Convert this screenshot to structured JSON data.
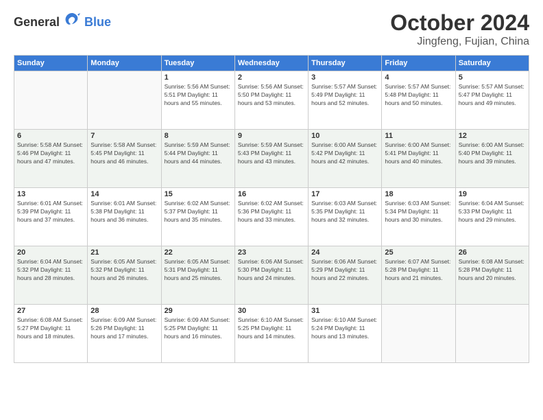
{
  "header": {
    "logo_general": "General",
    "logo_blue": "Blue",
    "month": "October 2024",
    "location": "Jingfeng, Fujian, China"
  },
  "weekdays": [
    "Sunday",
    "Monday",
    "Tuesday",
    "Wednesday",
    "Thursday",
    "Friday",
    "Saturday"
  ],
  "weeks": [
    [
      {
        "day": "",
        "info": ""
      },
      {
        "day": "",
        "info": ""
      },
      {
        "day": "1",
        "info": "Sunrise: 5:56 AM\nSunset: 5:51 PM\nDaylight: 11 hours and 55 minutes."
      },
      {
        "day": "2",
        "info": "Sunrise: 5:56 AM\nSunset: 5:50 PM\nDaylight: 11 hours and 53 minutes."
      },
      {
        "day": "3",
        "info": "Sunrise: 5:57 AM\nSunset: 5:49 PM\nDaylight: 11 hours and 52 minutes."
      },
      {
        "day": "4",
        "info": "Sunrise: 5:57 AM\nSunset: 5:48 PM\nDaylight: 11 hours and 50 minutes."
      },
      {
        "day": "5",
        "info": "Sunrise: 5:57 AM\nSunset: 5:47 PM\nDaylight: 11 hours and 49 minutes."
      }
    ],
    [
      {
        "day": "6",
        "info": "Sunrise: 5:58 AM\nSunset: 5:46 PM\nDaylight: 11 hours and 47 minutes."
      },
      {
        "day": "7",
        "info": "Sunrise: 5:58 AM\nSunset: 5:45 PM\nDaylight: 11 hours and 46 minutes."
      },
      {
        "day": "8",
        "info": "Sunrise: 5:59 AM\nSunset: 5:44 PM\nDaylight: 11 hours and 44 minutes."
      },
      {
        "day": "9",
        "info": "Sunrise: 5:59 AM\nSunset: 5:43 PM\nDaylight: 11 hours and 43 minutes."
      },
      {
        "day": "10",
        "info": "Sunrise: 6:00 AM\nSunset: 5:42 PM\nDaylight: 11 hours and 42 minutes."
      },
      {
        "day": "11",
        "info": "Sunrise: 6:00 AM\nSunset: 5:41 PM\nDaylight: 11 hours and 40 minutes."
      },
      {
        "day": "12",
        "info": "Sunrise: 6:00 AM\nSunset: 5:40 PM\nDaylight: 11 hours and 39 minutes."
      }
    ],
    [
      {
        "day": "13",
        "info": "Sunrise: 6:01 AM\nSunset: 5:39 PM\nDaylight: 11 hours and 37 minutes."
      },
      {
        "day": "14",
        "info": "Sunrise: 6:01 AM\nSunset: 5:38 PM\nDaylight: 11 hours and 36 minutes."
      },
      {
        "day": "15",
        "info": "Sunrise: 6:02 AM\nSunset: 5:37 PM\nDaylight: 11 hours and 35 minutes."
      },
      {
        "day": "16",
        "info": "Sunrise: 6:02 AM\nSunset: 5:36 PM\nDaylight: 11 hours and 33 minutes."
      },
      {
        "day": "17",
        "info": "Sunrise: 6:03 AM\nSunset: 5:35 PM\nDaylight: 11 hours and 32 minutes."
      },
      {
        "day": "18",
        "info": "Sunrise: 6:03 AM\nSunset: 5:34 PM\nDaylight: 11 hours and 30 minutes."
      },
      {
        "day": "19",
        "info": "Sunrise: 6:04 AM\nSunset: 5:33 PM\nDaylight: 11 hours and 29 minutes."
      }
    ],
    [
      {
        "day": "20",
        "info": "Sunrise: 6:04 AM\nSunset: 5:32 PM\nDaylight: 11 hours and 28 minutes."
      },
      {
        "day": "21",
        "info": "Sunrise: 6:05 AM\nSunset: 5:32 PM\nDaylight: 11 hours and 26 minutes."
      },
      {
        "day": "22",
        "info": "Sunrise: 6:05 AM\nSunset: 5:31 PM\nDaylight: 11 hours and 25 minutes."
      },
      {
        "day": "23",
        "info": "Sunrise: 6:06 AM\nSunset: 5:30 PM\nDaylight: 11 hours and 24 minutes."
      },
      {
        "day": "24",
        "info": "Sunrise: 6:06 AM\nSunset: 5:29 PM\nDaylight: 11 hours and 22 minutes."
      },
      {
        "day": "25",
        "info": "Sunrise: 6:07 AM\nSunset: 5:28 PM\nDaylight: 11 hours and 21 minutes."
      },
      {
        "day": "26",
        "info": "Sunrise: 6:08 AM\nSunset: 5:28 PM\nDaylight: 11 hours and 20 minutes."
      }
    ],
    [
      {
        "day": "27",
        "info": "Sunrise: 6:08 AM\nSunset: 5:27 PM\nDaylight: 11 hours and 18 minutes."
      },
      {
        "day": "28",
        "info": "Sunrise: 6:09 AM\nSunset: 5:26 PM\nDaylight: 11 hours and 17 minutes."
      },
      {
        "day": "29",
        "info": "Sunrise: 6:09 AM\nSunset: 5:25 PM\nDaylight: 11 hours and 16 minutes."
      },
      {
        "day": "30",
        "info": "Sunrise: 6:10 AM\nSunset: 5:25 PM\nDaylight: 11 hours and 14 minutes."
      },
      {
        "day": "31",
        "info": "Sunrise: 6:10 AM\nSunset: 5:24 PM\nDaylight: 11 hours and 13 minutes."
      },
      {
        "day": "",
        "info": ""
      },
      {
        "day": "",
        "info": ""
      }
    ]
  ]
}
